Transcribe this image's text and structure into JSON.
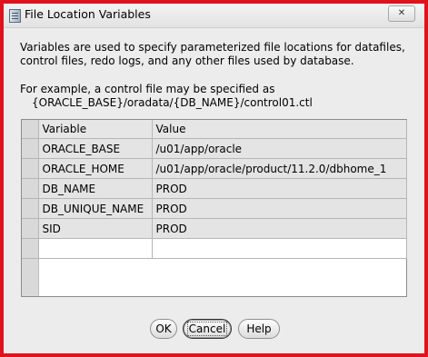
{
  "window": {
    "title": "File Location Variables",
    "close_label": "✕"
  },
  "description": {
    "line1": "Variables are used to specify parameterized file locations for datafiles,",
    "line2": "control files, redo logs, and any other files used by database.",
    "example_intro": "For example, a control file may be specified as",
    "example_path": "{ORACLE_BASE}/oradata/{DB_NAME}/control01.ctl"
  },
  "table": {
    "columns": [
      "Variable",
      "Value"
    ],
    "rows": [
      {
        "variable": "ORACLE_BASE",
        "value": "/u01/app/oracle"
      },
      {
        "variable": "ORACLE_HOME",
        "value": "/u01/app/oracle/product/11.2.0/dbhome_1"
      },
      {
        "variable": "DB_NAME",
        "value": "PROD"
      },
      {
        "variable": "DB_UNIQUE_NAME",
        "value": "PROD"
      },
      {
        "variable": "SID",
        "value": "PROD"
      }
    ]
  },
  "buttons": {
    "ok": "OK",
    "cancel": "Cancel",
    "help": "Help"
  }
}
